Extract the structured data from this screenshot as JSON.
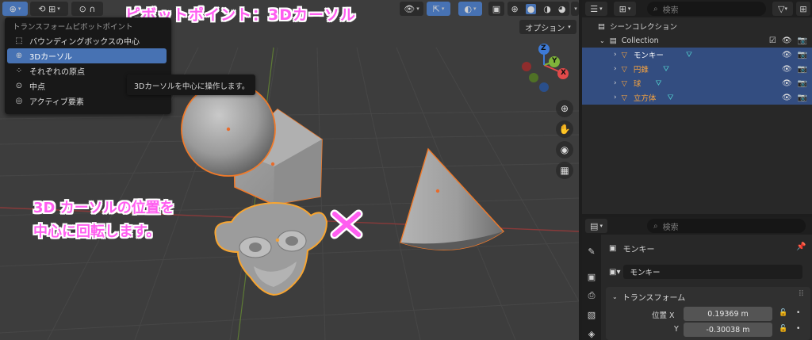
{
  "viewport": {
    "annotation_title": "ピボットポイント：3Dカーソル",
    "annotation_line1": "3D カーソルの位置を",
    "annotation_line2": "中心に回転します。",
    "options_label": "オプション",
    "pivot_menu": {
      "title": "トランスフォームピボットポイント",
      "items": [
        {
          "label": "バウンディングボックスの中心",
          "icon": "bounding-box-icon",
          "glyph": "⬚",
          "selected": false
        },
        {
          "label": "3Dカーソル",
          "icon": "cursor-3d-icon",
          "glyph": "⊕",
          "selected": true
        },
        {
          "label": "それぞれの原点",
          "icon": "individual-origins-icon",
          "glyph": "⁘",
          "selected": false
        },
        {
          "label": "中点",
          "icon": "median-point-icon",
          "glyph": "⊙",
          "selected": false
        },
        {
          "label": "アクティブ要素",
          "icon": "active-element-icon",
          "glyph": "◎",
          "selected": false
        }
      ]
    },
    "tooltip": "3Dカーソルを中心に操作します。",
    "gizmo": {
      "x": "X",
      "y": "Y",
      "z": "Z"
    }
  },
  "outliner": {
    "search_placeholder": "検索",
    "scene_collection": "シーンコレクション",
    "collection": "Collection",
    "objects": [
      {
        "name": "モンキー",
        "selected": true,
        "active": true
      },
      {
        "name": "円錐",
        "selected": true,
        "active": false
      },
      {
        "name": "球",
        "selected": true,
        "active": false
      },
      {
        "name": "立方体",
        "selected": true,
        "active": false
      }
    ]
  },
  "properties": {
    "search_placeholder": "検索",
    "object_name": "モンキー",
    "object_field": "モンキー",
    "panel_title": "トランスフォーム",
    "location_label": "位置 X",
    "y_label": "Y",
    "loc_x": "0.19369 m",
    "loc_y": "-0.30038 m"
  },
  "colors": {
    "accent": "#4772b3",
    "selection_outline": "#f07a2a",
    "annotation": "#ff5ef0",
    "axis_x": "#e24a4a",
    "axis_y": "#7fb43a",
    "axis_z": "#3d7ad6"
  }
}
